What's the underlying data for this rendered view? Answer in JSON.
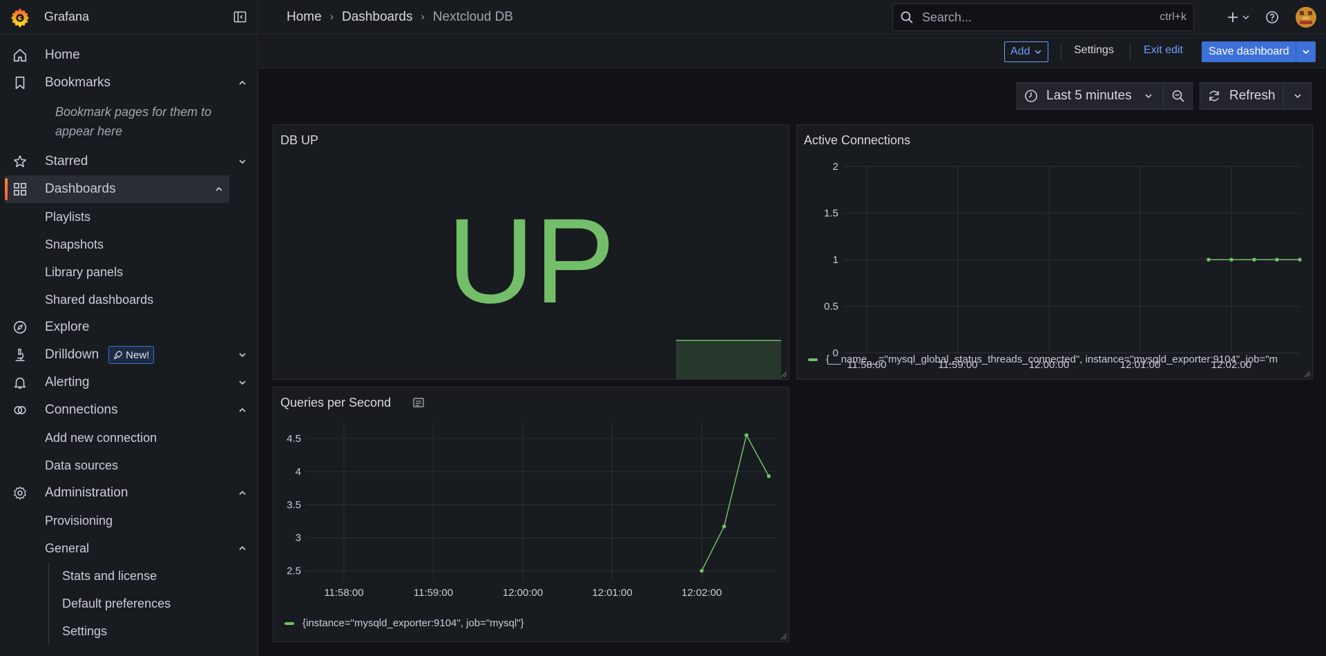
{
  "app": {
    "name": "Grafana"
  },
  "sidebar": {
    "items": [
      {
        "label": "Home"
      },
      {
        "label": "Bookmarks"
      },
      {
        "label": "Starred"
      },
      {
        "label": "Dashboards"
      },
      {
        "label": "Explore"
      },
      {
        "label": "Drilldown"
      },
      {
        "label": "Alerting"
      },
      {
        "label": "Connections"
      },
      {
        "label": "Administration"
      }
    ],
    "bookmark_hint": "Bookmark pages for them to appear here",
    "dashboards_children": [
      "Playlists",
      "Snapshots",
      "Library panels",
      "Shared dashboards"
    ],
    "drilldown_badge": "New!",
    "connections_children": [
      "Add new connection",
      "Data sources"
    ],
    "administration_children": [
      "Provisioning",
      "General"
    ],
    "general_children": [
      "Stats and license",
      "Default preferences",
      "Settings"
    ]
  },
  "breadcrumb": [
    "Home",
    "Dashboards",
    "Nextcloud DB"
  ],
  "search": {
    "placeholder": "Search...",
    "shortcut": "ctrl+k"
  },
  "toolbar": {
    "add_label": "Add",
    "settings_label": "Settings",
    "exit_edit_label": "Exit edit",
    "save_label": "Save dashboard"
  },
  "time": {
    "range_label": "Last 5 minutes",
    "refresh_label": "Refresh"
  },
  "colors": {
    "accent": "#3d71d9",
    "series": "#73bf69",
    "link": "#6e9fff",
    "brand": "#f55f3e"
  },
  "panels": {
    "db_up": {
      "title": "DB UP",
      "value": "UP"
    },
    "active_connections": {
      "title": "Active Connections",
      "legend": "{__name__=\"mysql_global_status_threads_connected\", instance=\"mysqld_exporter:9104\", job=\"m"
    },
    "qps": {
      "title": "Queries per Second",
      "legend": "{instance=\"mysqld_exporter:9104\", job=\"mysql\"}"
    }
  },
  "chart_data": [
    {
      "type": "line",
      "title": "Active Connections",
      "x_ticks": [
        "11:58:00",
        "11:59:00",
        "12:00:00",
        "12:01:00",
        "12:02:00"
      ],
      "y_ticks": [
        "0",
        "0.5",
        "1",
        "1.5",
        "2"
      ],
      "ylim": [
        0,
        2
      ],
      "x_range": [
        "11:57:45",
        "12:02:45"
      ],
      "series": [
        {
          "x": [
            "12:01:45",
            "12:02:00",
            "12:02:15",
            "12:02:30",
            "12:02:45"
          ],
          "values": [
            1,
            1,
            1,
            1,
            1
          ]
        }
      ]
    },
    {
      "type": "line",
      "title": "Queries per Second",
      "x_ticks": [
        "11:58:00",
        "11:59:00",
        "12:00:00",
        "12:01:00",
        "12:02:00"
      ],
      "y_ticks": [
        "2.5",
        "3",
        "3.5",
        "4",
        "4.5"
      ],
      "ylim": [
        2.35,
        4.75
      ],
      "x_range": [
        "11:57:35",
        "12:02:50"
      ],
      "series": [
        {
          "x": [
            "12:02:00",
            "12:02:15",
            "12:02:30",
            "12:02:45"
          ],
          "values": [
            2.5,
            3.17,
            4.55,
            3.93
          ]
        }
      ]
    },
    {
      "type": "area",
      "title": "DB UP sparkline",
      "values": [
        1,
        1,
        1,
        1,
        1
      ]
    }
  ]
}
